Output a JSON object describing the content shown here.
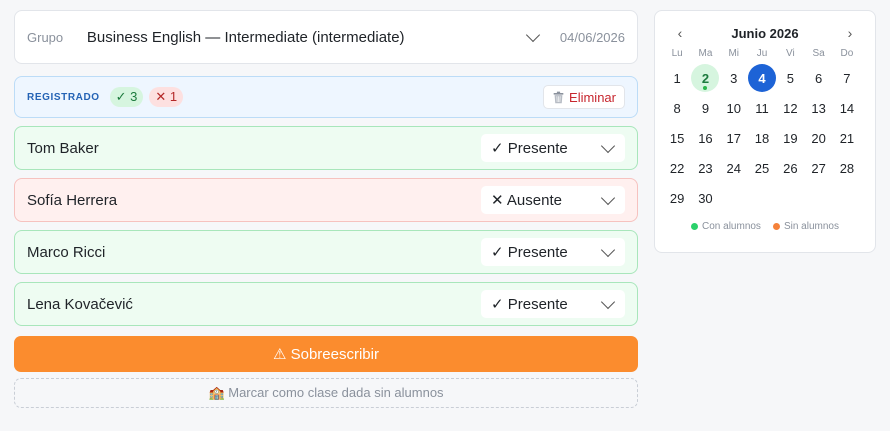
{
  "group": {
    "label": "Grupo",
    "selected": "Business English — Intermediate (intermediate)",
    "date": "04/06/2026"
  },
  "status": {
    "label": "REGISTRADO",
    "present_count": "✓ 3",
    "absent_count": "✕ 1",
    "delete_label": "Eliminar"
  },
  "students": [
    {
      "name": "Tom Baker",
      "attendance": "✓ Presente",
      "state": "present"
    },
    {
      "name": "Sofía Herrera",
      "attendance": "✕ Ausente",
      "state": "absent"
    },
    {
      "name": "Marco Ricci",
      "attendance": "✓ Presente",
      "state": "present"
    },
    {
      "name": "Lena Kovačević",
      "attendance": "✓ Presente",
      "state": "present"
    }
  ],
  "actions": {
    "overwrite_label": "⚠ Sobreescribir",
    "no_students_label": "🏫 Marcar como clase dada sin alumnos"
  },
  "calendar": {
    "title": "Junio 2026",
    "prev": "‹",
    "next": "›",
    "weekdays": [
      "Lu",
      "Ma",
      "Mi",
      "Ju",
      "Vi",
      "Sa",
      "Do"
    ],
    "days": [
      "1",
      "2",
      "3",
      "4",
      "5",
      "6",
      "7",
      "8",
      "9",
      "10",
      "11",
      "12",
      "13",
      "14",
      "15",
      "16",
      "17",
      "18",
      "19",
      "20",
      "21",
      "22",
      "23",
      "24",
      "25",
      "26",
      "27",
      "28",
      "29",
      "30"
    ],
    "with_students_day": "2",
    "selected_day": "4",
    "legend": [
      {
        "label": "Con alumnos",
        "color": "#2bd16b"
      },
      {
        "label": "Sin alumnos",
        "color": "#f5823a"
      }
    ]
  }
}
